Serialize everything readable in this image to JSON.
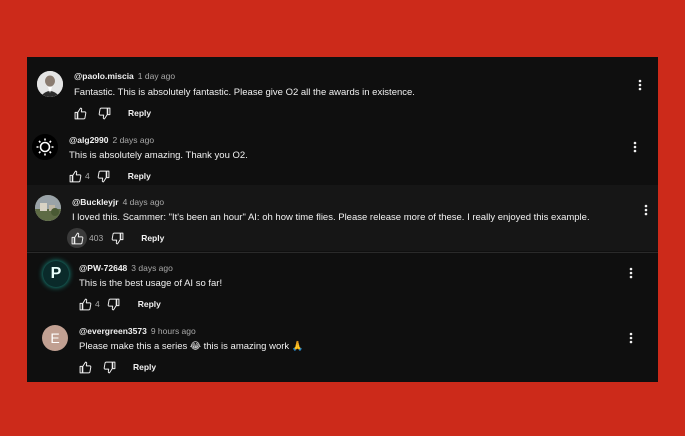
{
  "colors": {
    "page_background": "#cc2a1a",
    "panel_background": "#0f0f0f",
    "text_primary": "#f1f1f1",
    "text_secondary": "#aaaaaa"
  },
  "comments": [
    {
      "handle": "@paolo.miscia",
      "time": "1 day ago",
      "text": "Fantastic. This is absolutely fantastic. Please give O2 all the awards in existence.",
      "likes": "",
      "reply_label": "Reply"
    },
    {
      "handle": "@alg2990",
      "time": "2 days ago",
      "text": "This is absolutely amazing. Thank you O2.",
      "likes": "4",
      "reply_label": "Reply"
    },
    {
      "handle": "@Buckleyjr",
      "time": "4 days ago",
      "text": "I loved this. Scammer: \"It's been an hour\" AI: oh how time flies. Please release more of these. I really enjoyed this example.",
      "likes": "403",
      "reply_label": "Reply"
    },
    {
      "handle": "@PW-72648",
      "time": "3 days ago",
      "text": "This is the best usage of AI so far!",
      "likes": "4",
      "reply_label": "Reply",
      "avatar_letter": "P"
    },
    {
      "handle": "@evergreen3573",
      "time": "9 hours ago",
      "text": "Please make this a series 😂 this is amazing work 🙏",
      "likes": "",
      "reply_label": "Reply",
      "avatar_letter": "E"
    }
  ]
}
